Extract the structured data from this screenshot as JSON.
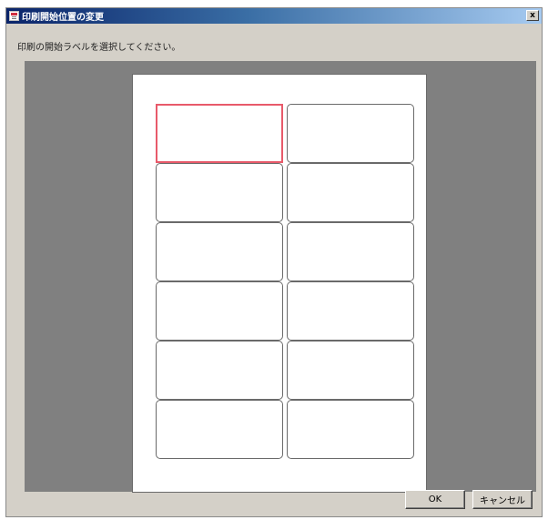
{
  "window": {
    "title": "印刷開始位置の変更",
    "close_label": "x"
  },
  "dialog": {
    "instruction": "印刷の開始ラベルを選択してください。"
  },
  "labels": {
    "columns": 2,
    "rows": 6,
    "selected_index": 0
  },
  "buttons": {
    "ok_label": "OK",
    "cancel_label": "キャンセル"
  },
  "colors": {
    "selected_border": "#e85a6a",
    "preview_background": "#808080",
    "dialog_background": "#d4d0c8"
  }
}
